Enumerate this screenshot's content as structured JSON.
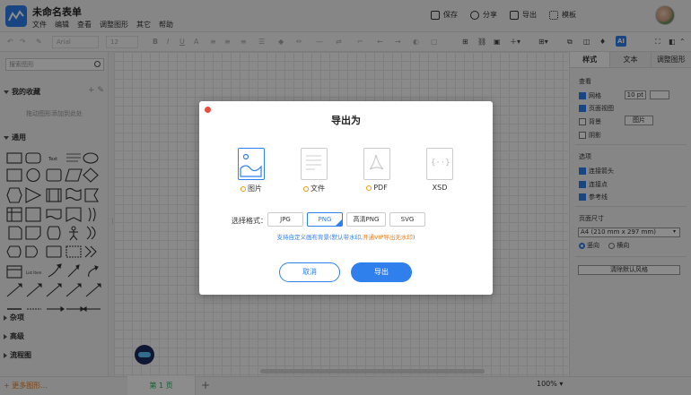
{
  "header": {
    "doc_title": "未命名表单",
    "menu": [
      "文件",
      "编辑",
      "查看",
      "调整图形",
      "其它",
      "帮助"
    ],
    "save": "保存",
    "share": "分享",
    "export": "导出",
    "template": "模板"
  },
  "toolbar": {
    "font": "Arial",
    "font_size": "12",
    "ai": "AI"
  },
  "left_panel": {
    "search_placeholder": "搜索图形",
    "favorites": "我的收藏",
    "drag_hint": "拖动图形添加到此处",
    "general": "通用",
    "misc": "杂项",
    "advanced": "高级",
    "flowchart": "流程图",
    "more_shapes": "+ 更多图形..."
  },
  "right_panel": {
    "tabs": [
      "样式",
      "文本",
      "调整图形"
    ],
    "view_label": "查看",
    "grid": "网格",
    "grid_size": "10 pt",
    "page_view": "页面视图",
    "background": "背景",
    "image_btn": "图片",
    "shadow": "阴影",
    "options_label": "选项",
    "connect_arrows": "连接箭头",
    "connect_points": "连接点",
    "guides": "参考线",
    "page_size_label": "页面尺寸",
    "page_size": "A4 (210 mm x 297 mm)",
    "portrait": "竖向",
    "landscape": "横向",
    "clear_style": "清除默认风格"
  },
  "bottom": {
    "page_tab": "第 1 页",
    "zoom": "100%"
  },
  "dialog": {
    "title": "导出为",
    "formats": [
      {
        "label": "图片"
      },
      {
        "label": "文件"
      },
      {
        "label": "PDF"
      },
      {
        "label": "XSD"
      }
    ],
    "select_label": "选择格式：",
    "format_tabs": [
      "JPG",
      "PNG",
      "高清PNG",
      "SVG"
    ],
    "hint_main": "支持自定义画布背景(默认带水印,",
    "hint_vip": "开通VIP导出无水印",
    "hint_end": ")",
    "cancel": "取消",
    "confirm": "导出"
  },
  "colors": {
    "accent": "#2f80ed",
    "close": "#e74c3c",
    "vip": "#e67e22"
  }
}
